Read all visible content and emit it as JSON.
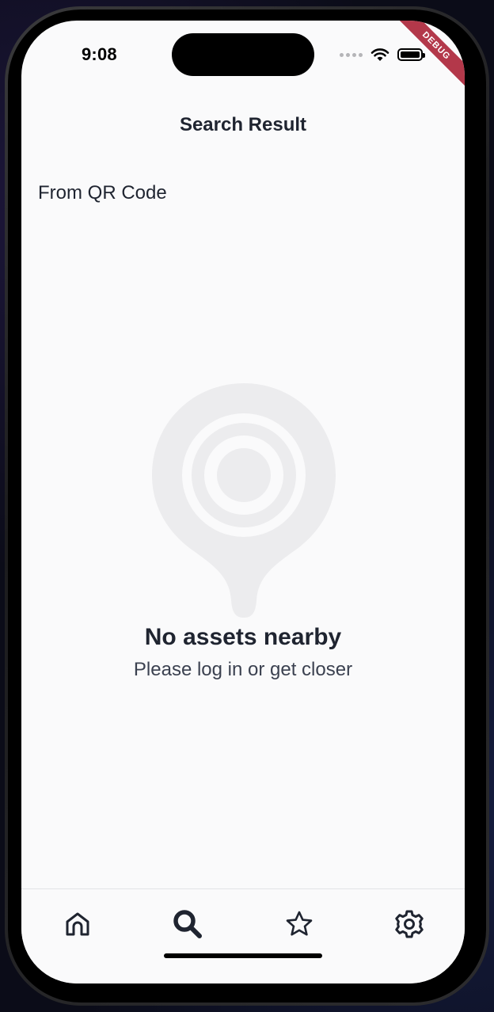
{
  "status_bar": {
    "time": "9:08"
  },
  "debug_banner": "DEBUG",
  "header": {
    "title": "Search Result"
  },
  "source_label": "From QR Code",
  "empty_state": {
    "icon": "location-pin-icon",
    "title": "No assets nearby",
    "subtitle": "Please log in or get closer"
  },
  "nav": {
    "items": [
      {
        "icon": "home-icon",
        "active": false
      },
      {
        "icon": "search-icon",
        "active": true
      },
      {
        "icon": "star-icon",
        "active": false
      },
      {
        "icon": "gear-icon",
        "active": false
      }
    ]
  },
  "colors": {
    "text_primary": "#1f2430",
    "text_secondary": "#3b4150",
    "icon_muted": "#ececee",
    "screen_bg": "#fafafb",
    "debug_ribbon": "#b3384a"
  }
}
